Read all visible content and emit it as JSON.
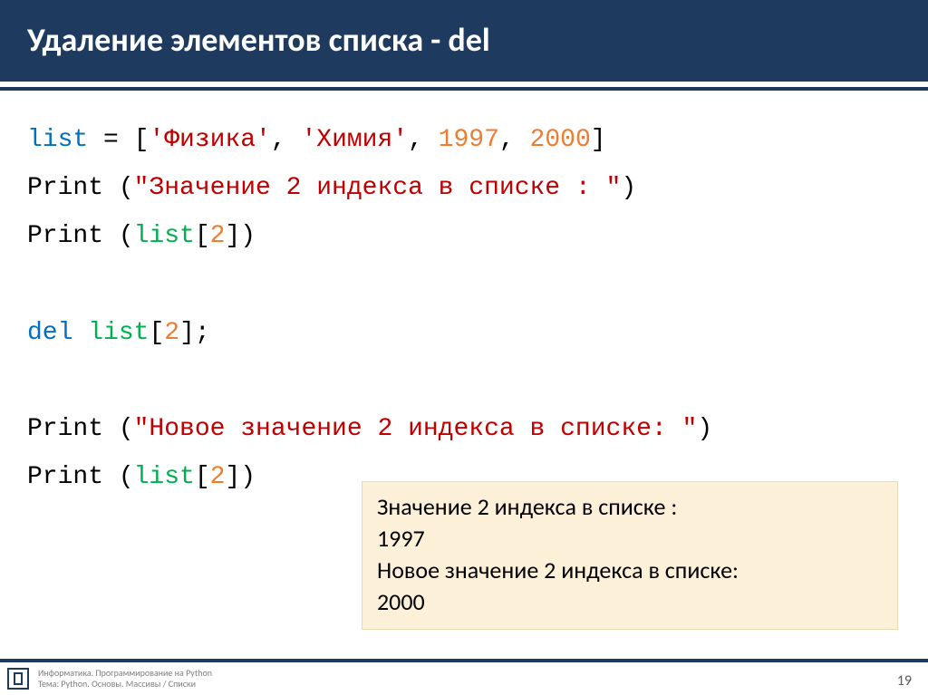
{
  "title": "Удаление элементов списка - del",
  "code": {
    "l1_a": "list",
    "l1_b": " = [",
    "l1_c": "'Физика'",
    "l1_d": ", ",
    "l1_e": "'Химия'",
    "l1_f": ", ",
    "l1_g": "1997",
    "l1_h": ", ",
    "l1_i": "2000",
    "l1_j": "]",
    "l2_a": "Print (",
    "l2_b": "\"Значение 2 индекса в списке : \"",
    "l2_c": ")",
    "l3_a": "Print (",
    "l3_b": "list",
    "l3_c": "[",
    "l3_d": "2",
    "l3_e": "])",
    "l4_a": "del ",
    "l4_b": "list",
    "l4_c": "[",
    "l4_d": "2",
    "l4_e": "];",
    "l5_a": "Print (",
    "l5_b": "\"Новое значение 2 индекса в списке: \"",
    "l5_c": ")",
    "l6_a": "Print (",
    "l6_b": "list",
    "l6_c": "[",
    "l6_d": "2",
    "l6_e": "])"
  },
  "output": {
    "line1": "Значение 2 индекса в списке :",
    "line2": "1997",
    "line3": "Новое значение 2 индекса в списке:",
    "line4": "2000"
  },
  "footer": {
    "line1": "Информатика. Программирование на Python",
    "line2": "Тема: Python. Основы. Массивы / Списки"
  },
  "page": "19"
}
